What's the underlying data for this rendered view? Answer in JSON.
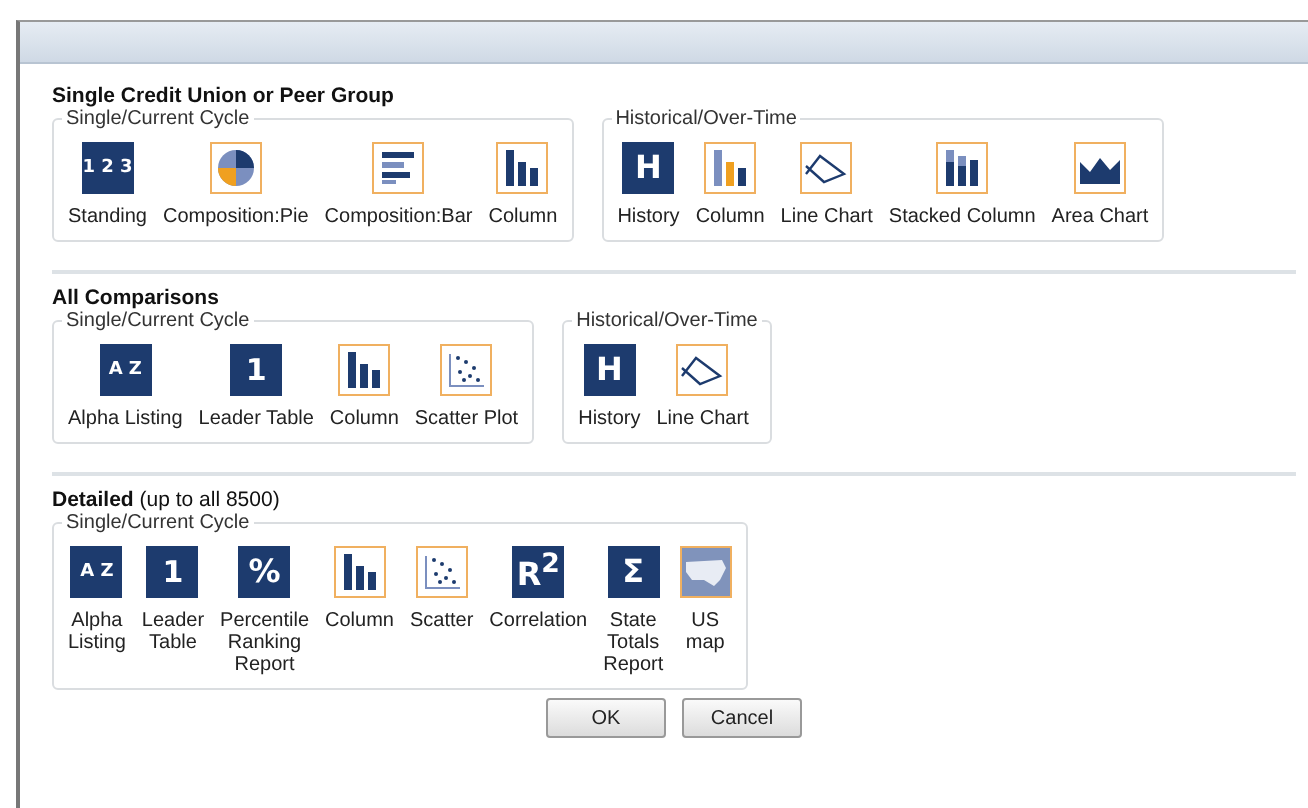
{
  "sections": [
    {
      "title": "Single Credit Union or Peer Group",
      "wrap": false,
      "groups": [
        {
          "legend": "Single/Current Cycle",
          "items": [
            {
              "label": "Standing",
              "kind": "standing",
              "glyph": "1 2 3"
            },
            {
              "label": "Composition:Pie",
              "kind": "pie"
            },
            {
              "label": "Composition:Bar",
              "kind": "bar"
            },
            {
              "label": "Column",
              "kind": "column"
            }
          ]
        },
        {
          "legend": "Historical/Over-Time",
          "items": [
            {
              "label": "History",
              "kind": "glyph",
              "glyph": "H"
            },
            {
              "label": "Column",
              "kind": "column2"
            },
            {
              "label": "Line Chart",
              "kind": "line"
            },
            {
              "label": "Stacked Column",
              "kind": "stacked"
            },
            {
              "label": "Area Chart",
              "kind": "area"
            }
          ]
        }
      ]
    },
    {
      "title": "All Comparisons",
      "wrap": false,
      "groups": [
        {
          "legend": "Single/Current Cycle",
          "items": [
            {
              "label": "Alpha Listing",
              "kind": "sort",
              "glyph": "A Z"
            },
            {
              "label": "Leader Table",
              "kind": "sort",
              "glyph": "1"
            },
            {
              "label": "Column",
              "kind": "column"
            },
            {
              "label": "Scatter Plot",
              "kind": "scatter"
            }
          ]
        },
        {
          "legend": "Historical/Over-Time",
          "items": [
            {
              "label": "History",
              "kind": "glyph",
              "glyph": "H"
            },
            {
              "label": "Line Chart",
              "kind": "line"
            }
          ]
        }
      ]
    },
    {
      "title": "Detailed",
      "note": "(up to all 8500)",
      "wrap": true,
      "groups": [
        {
          "legend": "Single/Current Cycle",
          "items": [
            {
              "label": "Alpha Listing",
              "kind": "sort",
              "glyph": "A Z"
            },
            {
              "label": "Leader Table",
              "kind": "sort",
              "glyph": "1"
            },
            {
              "label": "Percentile Ranking Report",
              "kind": "glyph",
              "glyph": "%"
            },
            {
              "label": "Column",
              "kind": "column"
            },
            {
              "label": "Scatter",
              "kind": "scatter"
            },
            {
              "label": "Correlation",
              "kind": "glyph",
              "glyph": "R$^{2}$"
            },
            {
              "label": "State Totals Report",
              "kind": "glyph",
              "glyph": "Σ"
            },
            {
              "label": "US map",
              "kind": "map"
            }
          ]
        }
      ]
    }
  ],
  "buttons": [
    "OK",
    "Cancel"
  ]
}
